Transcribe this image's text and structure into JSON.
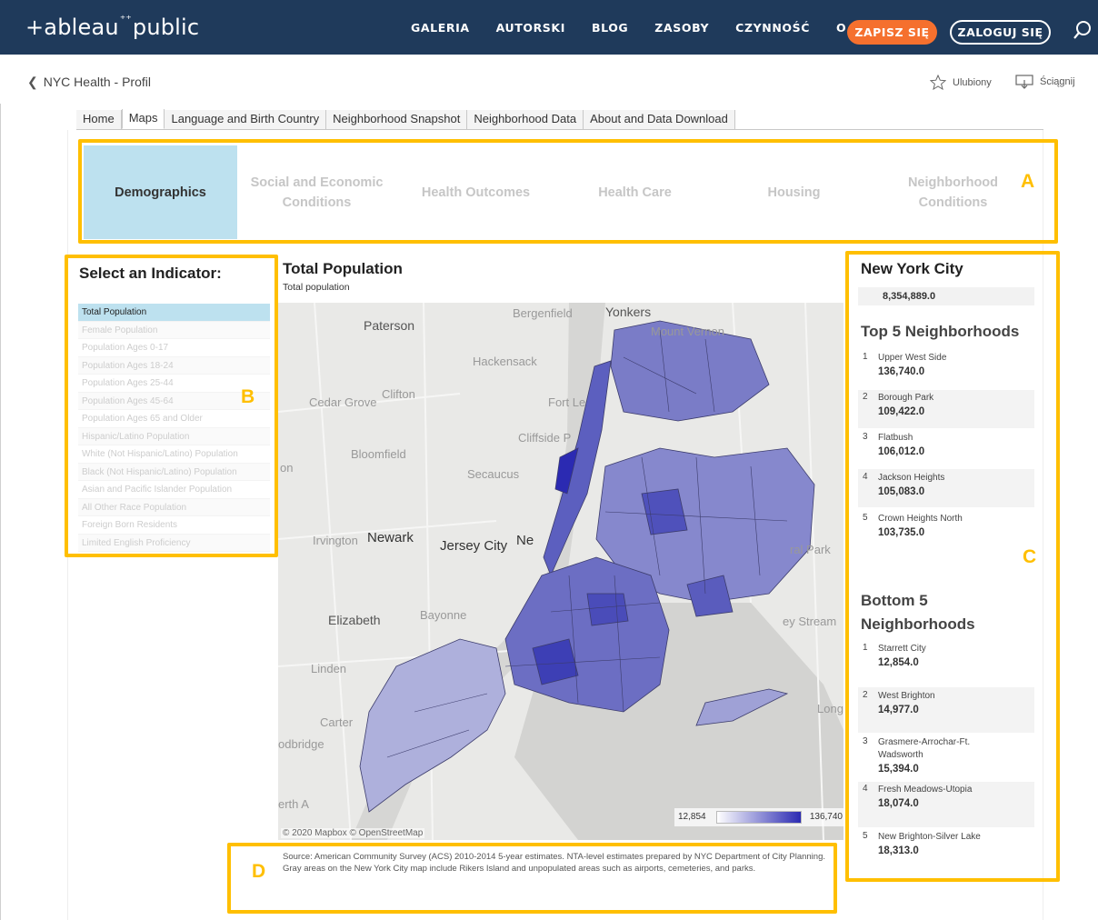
{
  "nav": {
    "logo": "+ableau",
    "logo_spark": "⁺⁺",
    "logo_tail": "public",
    "links": [
      "GALERIA",
      "AUTORSKI",
      "BLOG",
      "ZASOBY",
      "CZYNNOŚĆ",
      "O"
    ],
    "signup": "ZAPISZ SIĘ",
    "login": "ZALOGUJ SIĘ",
    "search_icon": "search-icon"
  },
  "subheader": {
    "back_label": "NYC Health - Profil",
    "favorite": "Ulubiony",
    "download": "Ściągnij"
  },
  "tabs": [
    "Home",
    "Maps",
    "Language and Birth Country",
    "Neighborhood Snapshot",
    "Neighborhood Data",
    "About and Data Download"
  ],
  "active_tab": "Maps",
  "categories": [
    "Demographics",
    "Social and Economic Conditions",
    "Health Outcomes",
    "Health Care",
    "Housing",
    "Neighborhood Conditions"
  ],
  "annotations": {
    "a": "A",
    "b": "B",
    "c": "C",
    "d": "D",
    "color": "#ffbf00"
  },
  "indicator": {
    "title": "Select an Indicator:",
    "items": [
      "Total Population",
      "Female Population",
      "Population Ages 0-17",
      "Population Ages 18-24",
      "Population Ages 25-44",
      "Population Ages 45-64",
      "Population Ages 65 and Older",
      "Hispanic/Latino Population",
      "White (Not Hispanic/Latino) Population",
      "Black (Not Hispanic/Latino) Population",
      "Asian and Pacific Islander Population",
      "All Other Race Population",
      "Foreign Born Residents",
      "Limited English Proficiency"
    ]
  },
  "map": {
    "title": "Total Population",
    "subtitle": "Total population",
    "place_labels": {
      "yonkers": "Yonkers",
      "paterson": "Paterson",
      "bergenfield": "Bergenfield",
      "mount_vernon": "Mount Vernon",
      "hackensack": "Hackensack",
      "cedar_grove": "Cedar Grove",
      "clifton": "Clifton",
      "fort_lee": "Fort Le",
      "cliffside": "Cliffside P",
      "bloomfield": "Bloomfield",
      "secaucus": "Secaucus",
      "on": "on",
      "irvington": "Irvington",
      "newark": "Newark",
      "jersey_city": "Jersey City",
      "new_york": "Ne",
      "elizabeth": "Elizabeth",
      "bayonne": "Bayonne",
      "linden": "Linden",
      "carteret": "Carter",
      "woodbridge": "odbridge",
      "perth": "erth A",
      "floral_park": "ral Park",
      "valley_stream": "ey Stream",
      "long": "Long"
    },
    "attribution": "© 2020 Mapbox © OpenStreetMap",
    "legend_min": "12,854",
    "legend_max": "136,740",
    "color_low": "#ffffff",
    "color_high": "#2b2ab2"
  },
  "source": {
    "line1": "Source: American Community Survey (ACS) 2010-2014 5-year estimates. NTA-level estimates prepared by NYC Department of City Planning.",
    "line2": "Gray areas on the New York City map include Rikers Island and unpopulated areas such as airports, cemeteries, and parks."
  },
  "summary": {
    "city_title": "New York City",
    "city_value": "8,354,889.0",
    "top_title": "Top 5 Neighborhoods",
    "top": [
      {
        "rank": "1",
        "name": "Upper West Side",
        "value": "136,740.0"
      },
      {
        "rank": "2",
        "name": "Borough Park",
        "value": "109,422.0"
      },
      {
        "rank": "3",
        "name": "Flatbush",
        "value": "106,012.0"
      },
      {
        "rank": "4",
        "name": "Jackson Heights",
        "value": "105,083.0"
      },
      {
        "rank": "5",
        "name": "Crown Heights North",
        "value": "103,735.0"
      }
    ],
    "bottom_title": "Bottom 5 Neighborhoods",
    "bottom": [
      {
        "rank": "1",
        "name": "Starrett City",
        "value": "12,854.0"
      },
      {
        "rank": "2",
        "name": "West Brighton",
        "value": "14,977.0"
      },
      {
        "rank": "3",
        "name": "Grasmere-Arrochar-Ft. Wadsworth",
        "value": "15,394.0"
      },
      {
        "rank": "4",
        "name": "Fresh Meadows-Utopia",
        "value": "18,074.0"
      },
      {
        "rank": "5",
        "name": "New Brighton-Silver Lake",
        "value": "18,313.0"
      }
    ]
  }
}
